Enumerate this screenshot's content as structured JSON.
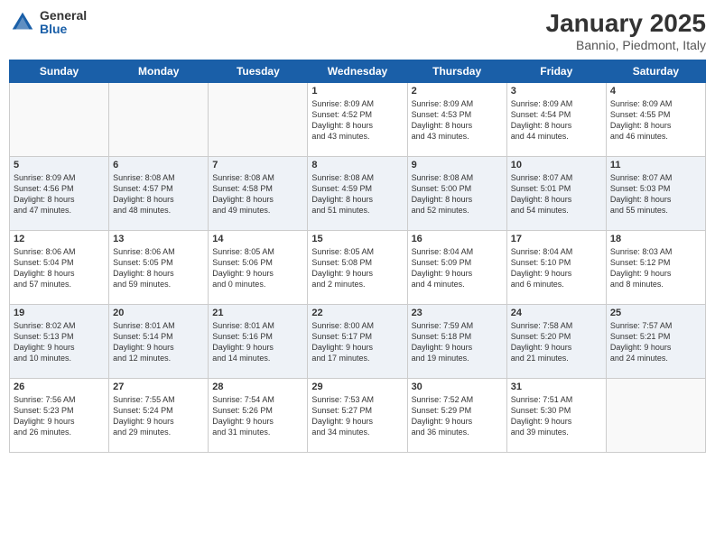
{
  "header": {
    "logo_general": "General",
    "logo_blue": "Blue",
    "month_title": "January 2025",
    "location": "Bannio, Piedmont, Italy"
  },
  "days_of_week": [
    "Sunday",
    "Monday",
    "Tuesday",
    "Wednesday",
    "Thursday",
    "Friday",
    "Saturday"
  ],
  "weeks": [
    [
      {
        "day": "",
        "info": ""
      },
      {
        "day": "",
        "info": ""
      },
      {
        "day": "",
        "info": ""
      },
      {
        "day": "1",
        "info": "Sunrise: 8:09 AM\nSunset: 4:52 PM\nDaylight: 8 hours\nand 43 minutes."
      },
      {
        "day": "2",
        "info": "Sunrise: 8:09 AM\nSunset: 4:53 PM\nDaylight: 8 hours\nand 43 minutes."
      },
      {
        "day": "3",
        "info": "Sunrise: 8:09 AM\nSunset: 4:54 PM\nDaylight: 8 hours\nand 44 minutes."
      },
      {
        "day": "4",
        "info": "Sunrise: 8:09 AM\nSunset: 4:55 PM\nDaylight: 8 hours\nand 46 minutes."
      }
    ],
    [
      {
        "day": "5",
        "info": "Sunrise: 8:09 AM\nSunset: 4:56 PM\nDaylight: 8 hours\nand 47 minutes."
      },
      {
        "day": "6",
        "info": "Sunrise: 8:08 AM\nSunset: 4:57 PM\nDaylight: 8 hours\nand 48 minutes."
      },
      {
        "day": "7",
        "info": "Sunrise: 8:08 AM\nSunset: 4:58 PM\nDaylight: 8 hours\nand 49 minutes."
      },
      {
        "day": "8",
        "info": "Sunrise: 8:08 AM\nSunset: 4:59 PM\nDaylight: 8 hours\nand 51 minutes."
      },
      {
        "day": "9",
        "info": "Sunrise: 8:08 AM\nSunset: 5:00 PM\nDaylight: 8 hours\nand 52 minutes."
      },
      {
        "day": "10",
        "info": "Sunrise: 8:07 AM\nSunset: 5:01 PM\nDaylight: 8 hours\nand 54 minutes."
      },
      {
        "day": "11",
        "info": "Sunrise: 8:07 AM\nSunset: 5:03 PM\nDaylight: 8 hours\nand 55 minutes."
      }
    ],
    [
      {
        "day": "12",
        "info": "Sunrise: 8:06 AM\nSunset: 5:04 PM\nDaylight: 8 hours\nand 57 minutes."
      },
      {
        "day": "13",
        "info": "Sunrise: 8:06 AM\nSunset: 5:05 PM\nDaylight: 8 hours\nand 59 minutes."
      },
      {
        "day": "14",
        "info": "Sunrise: 8:05 AM\nSunset: 5:06 PM\nDaylight: 9 hours\nand 0 minutes."
      },
      {
        "day": "15",
        "info": "Sunrise: 8:05 AM\nSunset: 5:08 PM\nDaylight: 9 hours\nand 2 minutes."
      },
      {
        "day": "16",
        "info": "Sunrise: 8:04 AM\nSunset: 5:09 PM\nDaylight: 9 hours\nand 4 minutes."
      },
      {
        "day": "17",
        "info": "Sunrise: 8:04 AM\nSunset: 5:10 PM\nDaylight: 9 hours\nand 6 minutes."
      },
      {
        "day": "18",
        "info": "Sunrise: 8:03 AM\nSunset: 5:12 PM\nDaylight: 9 hours\nand 8 minutes."
      }
    ],
    [
      {
        "day": "19",
        "info": "Sunrise: 8:02 AM\nSunset: 5:13 PM\nDaylight: 9 hours\nand 10 minutes."
      },
      {
        "day": "20",
        "info": "Sunrise: 8:01 AM\nSunset: 5:14 PM\nDaylight: 9 hours\nand 12 minutes."
      },
      {
        "day": "21",
        "info": "Sunrise: 8:01 AM\nSunset: 5:16 PM\nDaylight: 9 hours\nand 14 minutes."
      },
      {
        "day": "22",
        "info": "Sunrise: 8:00 AM\nSunset: 5:17 PM\nDaylight: 9 hours\nand 17 minutes."
      },
      {
        "day": "23",
        "info": "Sunrise: 7:59 AM\nSunset: 5:18 PM\nDaylight: 9 hours\nand 19 minutes."
      },
      {
        "day": "24",
        "info": "Sunrise: 7:58 AM\nSunset: 5:20 PM\nDaylight: 9 hours\nand 21 minutes."
      },
      {
        "day": "25",
        "info": "Sunrise: 7:57 AM\nSunset: 5:21 PM\nDaylight: 9 hours\nand 24 minutes."
      }
    ],
    [
      {
        "day": "26",
        "info": "Sunrise: 7:56 AM\nSunset: 5:23 PM\nDaylight: 9 hours\nand 26 minutes."
      },
      {
        "day": "27",
        "info": "Sunrise: 7:55 AM\nSunset: 5:24 PM\nDaylight: 9 hours\nand 29 minutes."
      },
      {
        "day": "28",
        "info": "Sunrise: 7:54 AM\nSunset: 5:26 PM\nDaylight: 9 hours\nand 31 minutes."
      },
      {
        "day": "29",
        "info": "Sunrise: 7:53 AM\nSunset: 5:27 PM\nDaylight: 9 hours\nand 34 minutes."
      },
      {
        "day": "30",
        "info": "Sunrise: 7:52 AM\nSunset: 5:29 PM\nDaylight: 9 hours\nand 36 minutes."
      },
      {
        "day": "31",
        "info": "Sunrise: 7:51 AM\nSunset: 5:30 PM\nDaylight: 9 hours\nand 39 minutes."
      },
      {
        "day": "",
        "info": ""
      }
    ]
  ]
}
